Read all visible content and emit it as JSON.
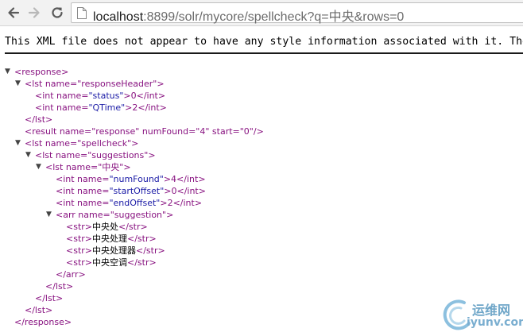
{
  "browser": {
    "url_host": "localhost",
    "url_rest": ":8899/solr/mycore/spellcheck?q=中央&rows=0"
  },
  "notice": "This XML file does not appear to have any style information associated with it. The",
  "xml": {
    "l1": "<response>",
    "l2": "<lst name=\"responseHeader\">",
    "l3": [
      "<int name=",
      "\"status\"",
      ">0</int>"
    ],
    "l4": [
      "<int name=",
      "\"QTime\"",
      ">2</int>"
    ],
    "l5": "</lst>",
    "l6": "<result name=\"response\" numFound=\"4\" start=\"0\"/>",
    "l7": "<lst name=\"spellcheck\">",
    "l8": "<lst name=\"suggestions\">",
    "l9": "<lst name=\"中央\">",
    "l10": [
      "<int name=",
      "\"numFound\"",
      ">4</int>"
    ],
    "l11": [
      "<int name=",
      "\"startOffset\"",
      ">0</int>"
    ],
    "l12": [
      "<int name=",
      "\"endOffset\"",
      ">2</int>"
    ],
    "l13": "<arr name=\"suggestion\">",
    "s1": "中央处",
    "s2": "中央处理",
    "s3": "中央处理器",
    "s4": "中央空调",
    "l18": "</arr>",
    "l19": "</lst>",
    "l20": "</lst>",
    "l21": "</lst>",
    "l22": "</response>"
  },
  "watermark": {
    "line1": "运维网",
    "line2": "iyunv.com"
  },
  "colors": {
    "tag": "#881280",
    "attr_name": "#994500",
    "attr_value": "#1a1aa6"
  }
}
